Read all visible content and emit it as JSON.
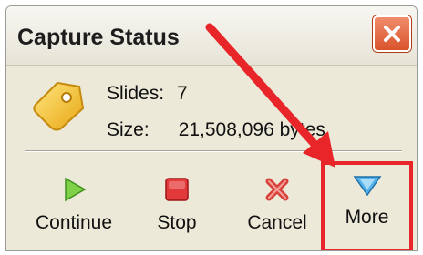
{
  "window": {
    "title": "Capture Status",
    "close_icon": "close-x-icon"
  },
  "info": {
    "icon": "tag-label-icon",
    "slides_label": "Slides:",
    "slides_value": "7",
    "size_label": "Size:",
    "size_value": "21,508,096 bytes"
  },
  "toolbar": {
    "continue_label": "Continue",
    "continue_icon": "play-icon",
    "stop_label": "Stop",
    "stop_icon": "stop-icon",
    "cancel_label": "Cancel",
    "cancel_icon": "cancel-x-icon",
    "more_label": "More",
    "more_icon": "triangle-down-icon"
  },
  "annotation": {
    "color": "#e8262a"
  }
}
